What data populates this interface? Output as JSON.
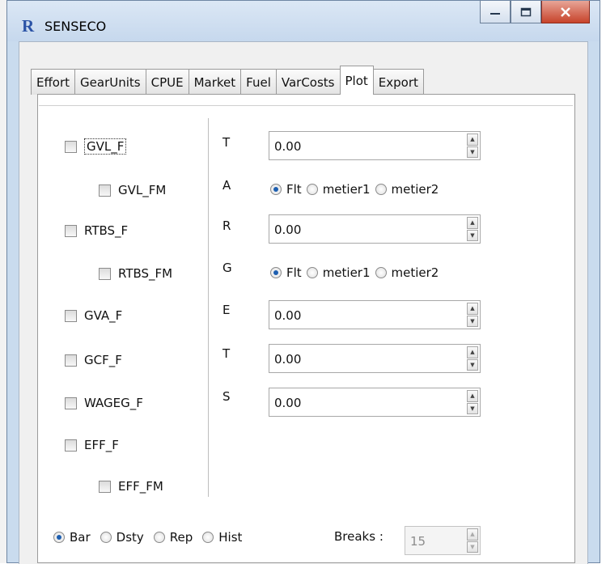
{
  "window": {
    "title": "SENSECO",
    "app_icon": "R",
    "buttons": [
      "minimize",
      "maximize",
      "close"
    ]
  },
  "tabs": [
    "Effort",
    "GearUnits",
    "CPUE",
    "Market",
    "Fuel",
    "VarCosts",
    "Plot",
    "Export"
  ],
  "active_tab": "Plot",
  "checkboxes": [
    {
      "label": "GVL_F",
      "checked": false,
      "focused": true
    },
    {
      "label": "GVL_FM",
      "checked": false
    },
    {
      "label": "RTBS_F",
      "checked": false
    },
    {
      "label": "RTBS_FM",
      "checked": false
    },
    {
      "label": "GVA_F",
      "checked": false
    },
    {
      "label": "GCF_F",
      "checked": false
    },
    {
      "label": "WAGEG_F",
      "checked": false
    },
    {
      "label": "EFF_F",
      "checked": false
    },
    {
      "label": "EFF_FM",
      "checked": false
    }
  ],
  "side_letters": [
    "T",
    "A",
    "R",
    "G",
    "E",
    "T",
    "S"
  ],
  "spin_values": [
    "0.00",
    "0.00",
    "0.00",
    "0.00",
    "0.00"
  ],
  "radio_groups": [
    {
      "options": [
        "Flt",
        "metier1",
        "metier2"
      ],
      "selected": "Flt"
    },
    {
      "options": [
        "Flt",
        "metier1",
        "metier2"
      ],
      "selected": "Flt"
    }
  ],
  "plot_types": {
    "options": [
      "Bar",
      "Dsty",
      "Rep",
      "Hist"
    ],
    "selected": "Bar"
  },
  "breaks": {
    "label": "Breaks :",
    "value": "15"
  },
  "icons": {
    "window_minimize": "minimize-icon",
    "window_maximize": "maximize-icon",
    "window_close": "close-icon"
  }
}
